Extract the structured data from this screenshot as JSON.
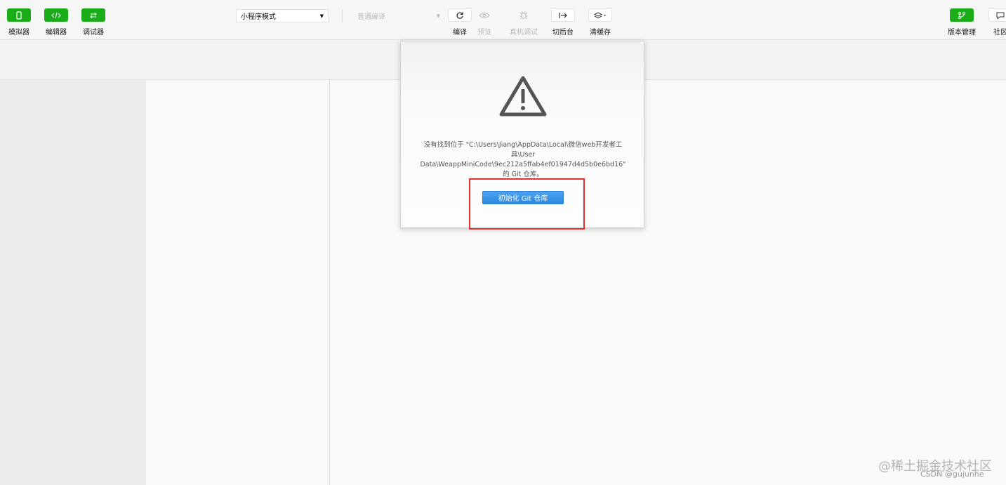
{
  "toolbar": {
    "simulator": "模拟器",
    "editor": "编辑器",
    "debugger": "调试器",
    "mode_select": "小程序模式",
    "compile_select": "普通编译",
    "compile": "编译",
    "preview": "预览",
    "remote_debug": "真机调试",
    "background": "切后台",
    "clear_cache": "清缓存",
    "version_mgmt": "版本管理",
    "community": "社区"
  },
  "dialog": {
    "message_lines": [
      "没有找到位于 \"C:\\Users\\Jiang\\AppData\\Local\\微信web开发者工",
      "具\\User",
      "Data\\WeappMiniCode\\9ec212a5ffab4ef01947d4d5b0e6bd16\"",
      "的 Git 仓库。"
    ],
    "init_button": "初始化 Git 仓库"
  },
  "watermark": {
    "line1": "@稀土掘金技术社区",
    "line2": "CSDN @gujunhe"
  },
  "colors": {
    "green": "#1aad19",
    "primary_button": "#2a86e0",
    "highlight_box": "#e0312d"
  }
}
